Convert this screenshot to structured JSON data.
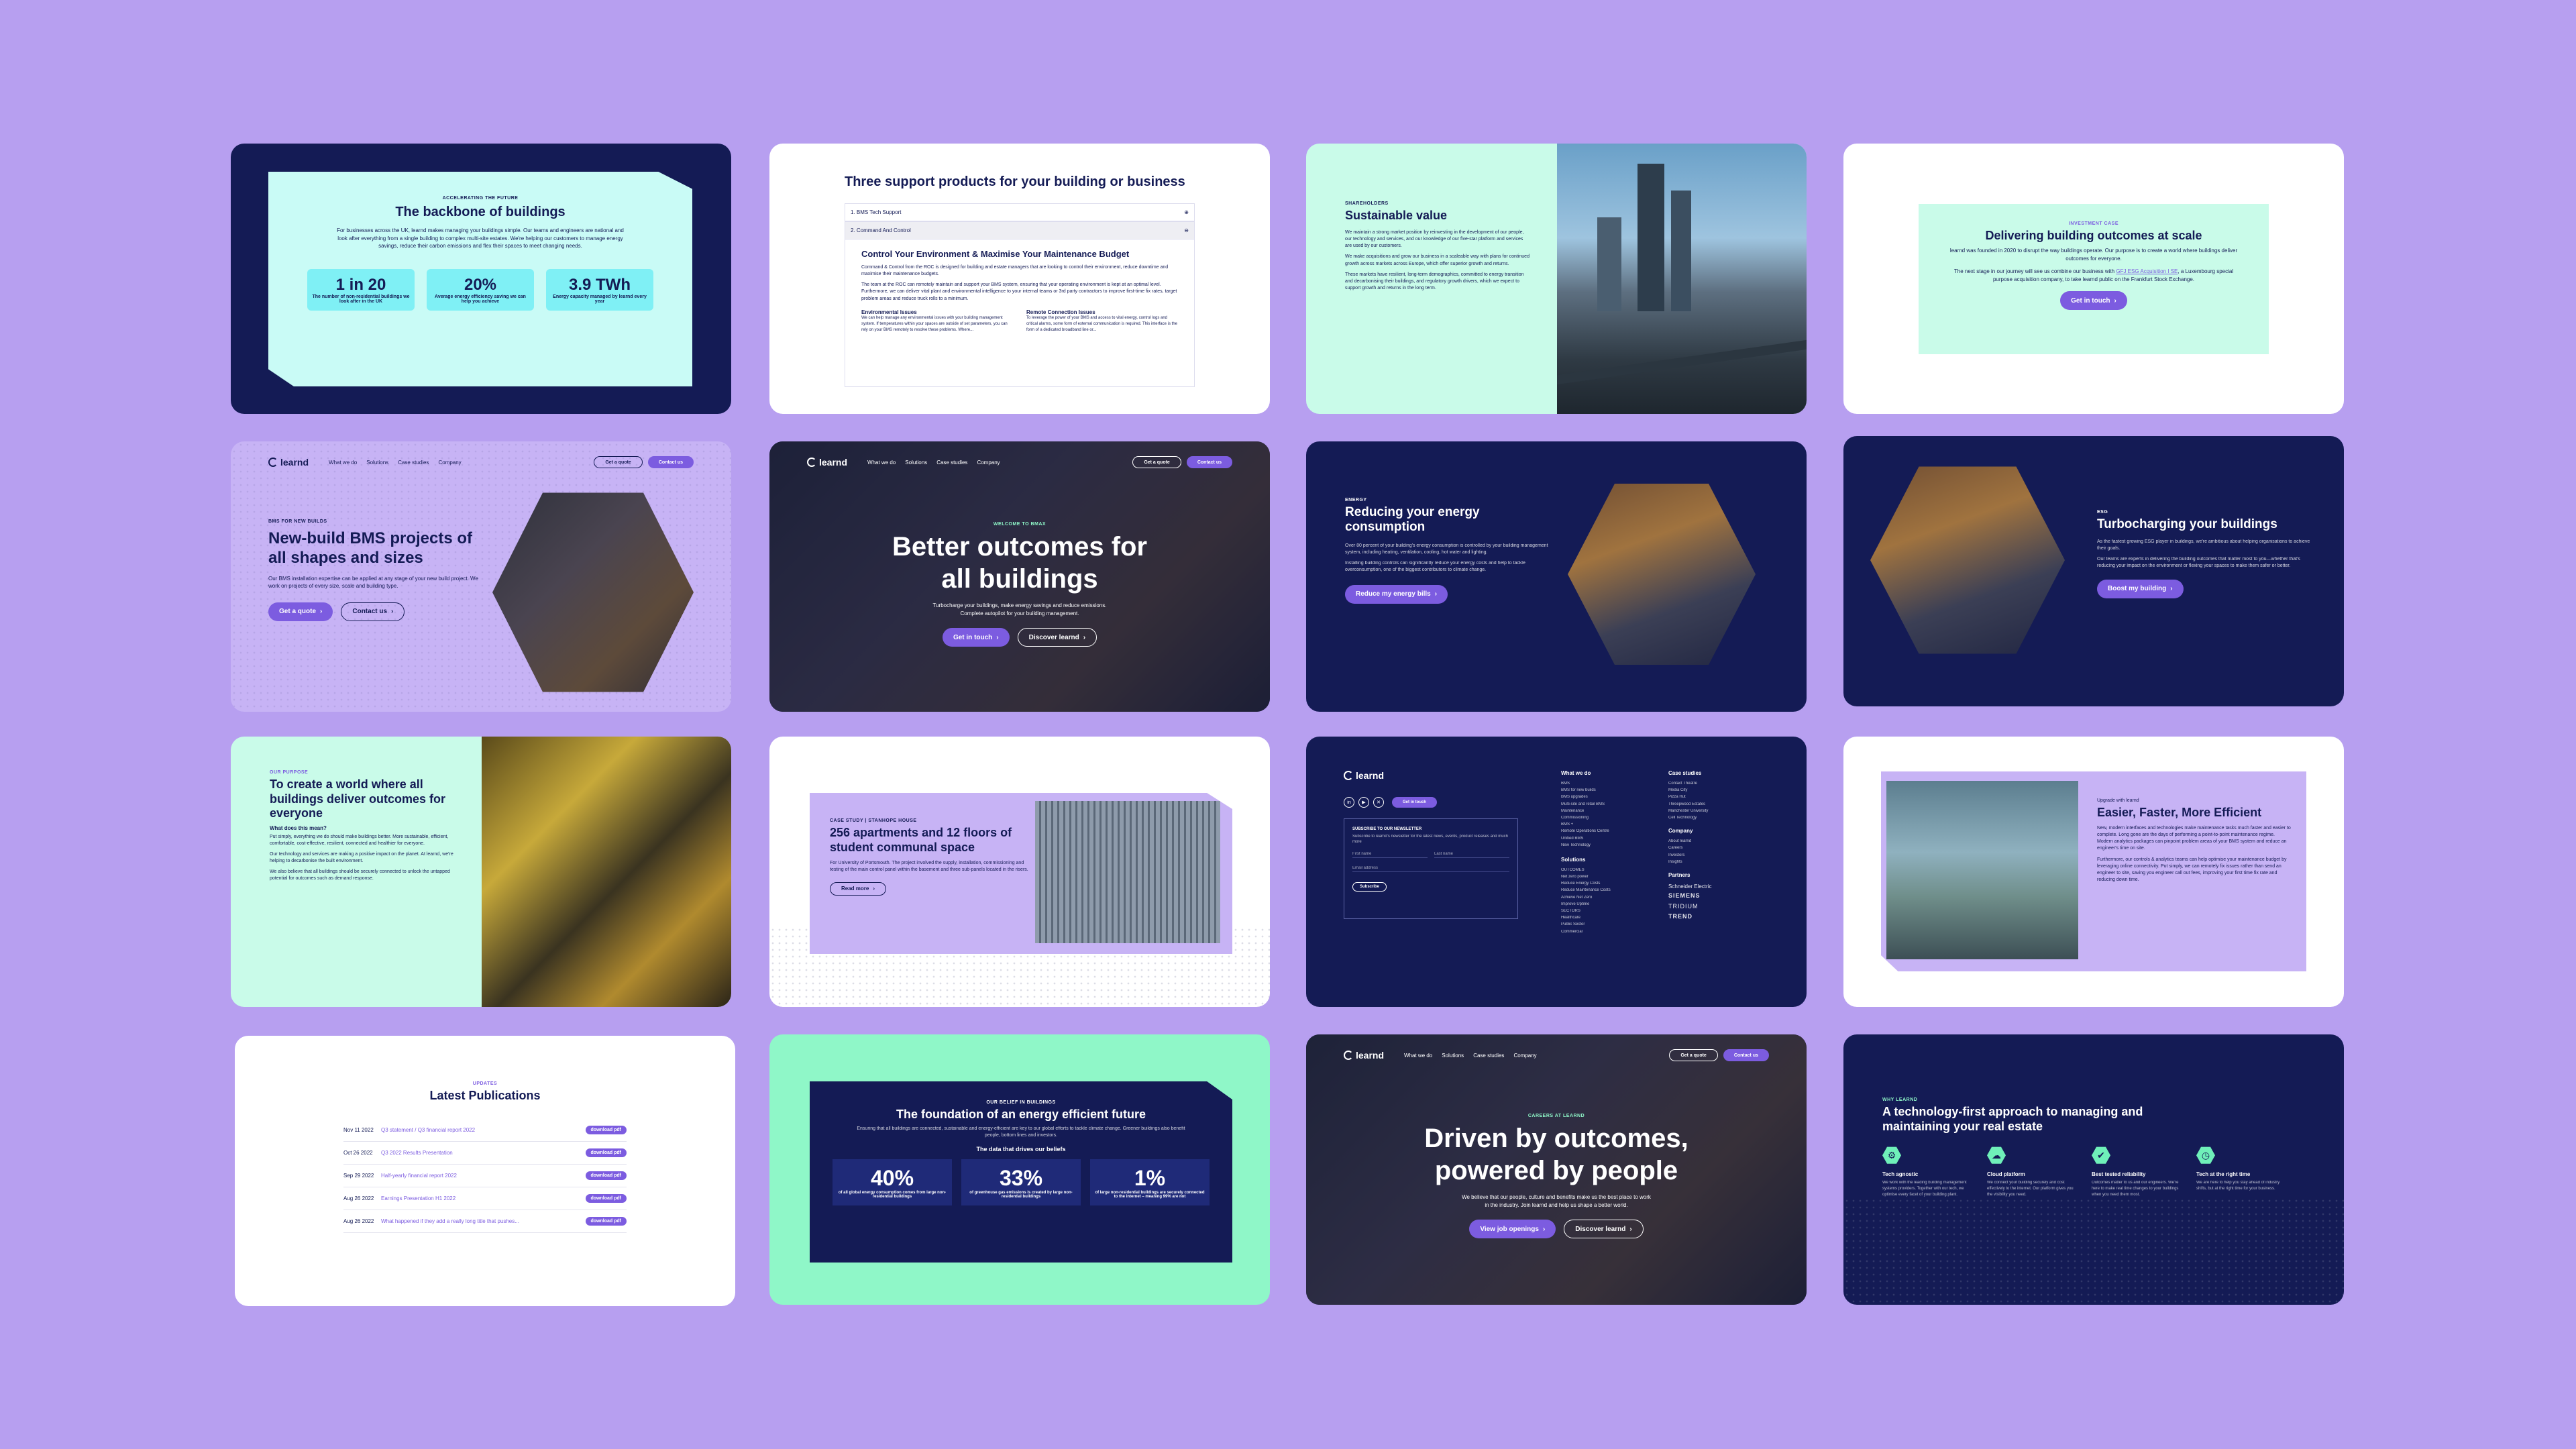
{
  "c1": {
    "eyebrow": "ACCELERATING THE FUTURE",
    "title": "The backbone of buildings",
    "body": "For businesses across the UK, learnd makes managing your buildings simple. Our teams and engineers are national and look after everything from a single building to complex multi-site estates. We're helping our customers to manage energy savings, reduce their carbon emissions and flex their spaces to meet changing needs.",
    "stats": [
      {
        "value": "1 in 20",
        "label": "The number of non-residential buildings we look after in the UK"
      },
      {
        "value": "20%",
        "label": "Average energy efficiency saving we can help you achieve"
      },
      {
        "value": "3.9 TWh",
        "label": "Energy capacity managed by learnd every year"
      }
    ]
  },
  "c2": {
    "title": "Three support products for your building or business",
    "acc1": "1. BMS Tech Support",
    "acc2": "2. Command And Control",
    "subtitle": "Control Your Environment & Maximise Your Maintenance Budget",
    "body1": "Command & Control from the ROC is designed for building and estate managers that are looking to control their environment, reduce downtime and maximise their maintenance budgets.",
    "body2": "The team at the ROC can remotely maintain and support your BMS system, ensuring that your operating environment is kept at an optimal level. Furthermore, we can deliver vital plant and environmental intelligence to your internal teams or 3rd party contractors to improve first-time fix rates, target problem areas and reduce truck rolls to a minimum.",
    "col1_title": "Environmental Issues",
    "col1_body": "We can help manage any environmental issues with your building management system. If temperatures within your spaces are outside of set parameters, you can rely on your BMS remotely to resolve these problems. Where...",
    "col2_title": "Remote Connection Issues",
    "col2_body": "To leverage the power of your BMS and access to vital energy, control logs and critical alarms, some form of external communication is required. This interface is the form of a dedicated broadband line or..."
  },
  "c3": {
    "eyebrow": "SHAREHOLDERS",
    "title": "Sustainable value",
    "p1": "We maintain a strong market position by reinvesting in the development of our people, our technology and services, and our knowledge of our five-star platform and services are used by our customers.",
    "p2": "We make acquisitions and grow our business in a scaleable way with plans for continued growth across markets across Europe, which offer superior growth and returns.",
    "p3": "These markets have resilient, long-term demographics, committed to energy transition and decarbonising their buildings, and regulatory growth drivers, which we expect to support growth and returns in the long term."
  },
  "c4": {
    "eyebrow": "INVESTMENT CASE",
    "title": "Delivering building outcomes at scale",
    "p1": "learnd was founded in 2020 to disrupt the way buildings operate. Our purpose is to create a world where buildings deliver outcomes for everyone.",
    "p2a": "The next stage in our journey will see us combine our business with ",
    "p2link": "GFJ ESG Acquisition I SE",
    "p2b": ", a Luxembourg special purpose acquisition company, to take learnd public on the Frankfurt Stock Exchange.",
    "button": "Get in touch"
  },
  "nav": {
    "logo": "learnd",
    "links": [
      "What we do",
      "Solutions",
      "Case studies",
      "Company"
    ],
    "quote": "Get a quote",
    "contact": "Contact us"
  },
  "c5": {
    "eyebrow": "BMS FOR NEW BUILDS",
    "title": "New-build BMS projects of all shapes and sizes",
    "body": "Our BMS installation expertise can be applied at any stage of your new build project. We work on projects of every size, scale and building type.",
    "btn1": "Get a quote",
    "btn2": "Contact us"
  },
  "c6": {
    "eyebrow": "WELCOME TO BMAX",
    "title": "Better outcomes for all buildings",
    "body": "Turbocharge your buildings, make energy savings and reduce emissions. Complete autopilot for your building management.",
    "btn1": "Get in touch",
    "btn2": "Discover learnd"
  },
  "c7": {
    "eyebrow": "ENERGY",
    "title": "Reducing your energy consumption",
    "p1": "Over 80 percent of your building's energy consumption is controlled by your building management system, including heating, ventilation, cooling, hot water and lighting.",
    "p2": "Installing building controls can significantly reduce your energy costs and help to tackle overconsumption, one of the biggest contributors to climate change.",
    "button": "Reduce my energy bills"
  },
  "c8": {
    "eyebrow": "ESG",
    "title": "Turbocharging your buildings",
    "p1": "As the fastest growing ESG player in buildings, we're ambitious about helping organisations to achieve their goals.",
    "p2": "Our teams are experts in delivering the building outcomes that matter most to you—whether that's reducing your impact on the environment or flexing your spaces to make them safer or better.",
    "button": "Boost my building"
  },
  "c9": {
    "eyebrow": "OUR PURPOSE",
    "title": "To create a world where all buildings deliver outcomes for everyone",
    "sub": "What does this mean?",
    "p1": "Put simply, everything we do should make buildings better. More sustainable, efficient, comfortable, cost-effective, resilient, connected and healthier for everyone.",
    "p2": "Our technology and services are making a positive impact on the planet. At learnd, we're helping to decarbonise the built environment.",
    "p3": "We also believe that all buildings should be securely connected to unlock the untapped potential for outcomes such as demand response."
  },
  "c10": {
    "eyebrow": "CASE STUDY | STANHOPE HOUSE",
    "title": "256 apartments and 12 floors of student communal space",
    "body": "For University of Portsmouth. The project involved the supply, installation, commissioning and testing of the main control panel within the basement and three sub-panels located in the risers.",
    "button": "Read more"
  },
  "c11": {
    "logo": "learnd",
    "touch": "Get in touch",
    "newsletter": "SUBSCRIBE TO OUR NEWSLETTER",
    "newsletter_body": "Subscribe to learnd's newsletter for the latest news, events, product releases and much more",
    "first": "First name",
    "last": "Last name",
    "email": "Email address",
    "subscribe": "Subscribe",
    "col1": {
      "title": "What we do",
      "items": [
        "BMS",
        "BMS for new builds",
        "BMS upgrades",
        "Multi-site and retail BMS",
        "Maintenance",
        "Commissioning",
        "BMS +",
        "Remote Operations Centre",
        "Unified BMS",
        "New Technology"
      ]
    },
    "col2": {
      "title": "Solutions",
      "items": [
        "OUTCOMES",
        "Net zero power",
        "Reduce Energy Costs",
        "Reduce Maintenance Costs",
        "Achieve Net Zero",
        "Improve Uptime",
        "SECTORS",
        "Healthcare",
        "Public Sector",
        "Commercial",
        "Retail",
        "Data Centres"
      ]
    },
    "col3": {
      "title": "Case studies",
      "items": [
        "Contact Theatre",
        "Media City",
        "Pizza Hut",
        "Threepwood Estates",
        "Manchester University",
        "Cell Technology"
      ]
    },
    "col4": {
      "title": "Company",
      "items": [
        "About learnd",
        "Careers",
        "Investors",
        "Insights"
      ]
    },
    "partners": {
      "title": "Partners",
      "items": [
        "Schneider Electric",
        "SIEMENS",
        "TRIDIUM",
        "TREND"
      ]
    }
  },
  "c12": {
    "eyebrow": "Upgrade with learnd",
    "title": "Easier, Faster, More Efficient",
    "p1": "New, modern interfaces and technologies make maintenance tasks much faster and easier to complete. Long gone are the days of performing a point-to-point maintenance regime. Modern analytics packages can pinpoint problem areas of your BMS system and reduce an engineer's time on site.",
    "p2": "Furthermore, our controls & analytics teams can help optimise your maintenance budget by leveraging online connectivity. Put simply, we can remotely fix issues rather than send an engineer to site, saving you engineer call out fees, improving your first time fix rate and reducing down time."
  },
  "c13": {
    "eyebrow": "UPDATES",
    "title": "Latest Publications",
    "download": "download pdf",
    "rows": [
      {
        "date": "Nov 11 2022",
        "title": "Q3 statement / Q3 financial report 2022"
      },
      {
        "date": "Oct 26 2022",
        "title": "Q3 2022 Results Presentation"
      },
      {
        "date": "Sep 29 2022",
        "title": "Half-yearly financial report 2022"
      },
      {
        "date": "Aug 26 2022",
        "title": "Earnings Presentation H1 2022"
      },
      {
        "date": "Aug 26 2022",
        "title": "What happened if they add a really long title that pushes..."
      }
    ]
  },
  "c14": {
    "eyebrow": "OUR BELIEF IN BUILDINGS",
    "title": "The foundation of an energy efficient future",
    "body": "Ensuring that all buildings are connected, sustainable and energy-efficient are key to our global efforts to tackle climate change. Greener buildings also benefit people, bottom lines and investors.",
    "sub": "The data that drives our beliefs",
    "stats": [
      {
        "value": "40%",
        "label": "of all global energy consumption comes from large non-residential buildings"
      },
      {
        "value": "33%",
        "label": "of greenhouse gas emissions is created by large non-residential buildings"
      },
      {
        "value": "1%",
        "label": "of large non-residential buildings are securely connected to the internet – meaning 99% are not"
      }
    ]
  },
  "c15": {
    "eyebrow": "CAREERS AT LEARND",
    "title": "Driven by outcomes, powered by people",
    "body": "We believe that our people, culture and benefits make us the best place to work in the industry. Join learnd and help us shape a better world.",
    "btn1": "View job openings",
    "btn2": "Discover learnd"
  },
  "c16": {
    "eyebrow": "WHY LEARND",
    "title": "A technology-first approach to managing and maintaining your real estate",
    "features": [
      {
        "title": "Tech agnostic",
        "body": "We work with the leading building management systems providers. Together with our tech, we optimise every facet of your building plant."
      },
      {
        "title": "Cloud platform",
        "body": "We connect your building securely and cost effectively to the internet. Our platform gives you the visibility you need."
      },
      {
        "title": "Best tested reliability",
        "body": "Outcomes matter to us and our engineers. We're here to make real time changes to your buildings when you need them most."
      },
      {
        "title": "Tech at the right time",
        "body": "We are here to help you stay ahead of industry shifts, but at the right time for your business."
      }
    ]
  }
}
